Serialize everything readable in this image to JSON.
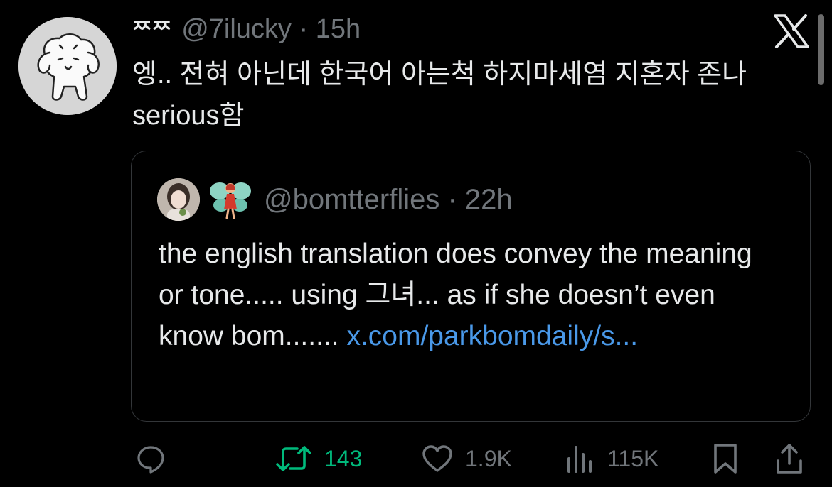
{
  "tweet": {
    "display_name": "ᄍᄍ",
    "handle": "@7ilucky",
    "separator": "·",
    "time": "15h",
    "text": "엥.. 전혀 아닌데 한국어 아는척 하지마세염 지혼자 존나 serious함"
  },
  "quoted": {
    "handle": "@bomtterflies",
    "separator": "·",
    "time": "22h",
    "text": "the english translation does convey the meaning or tone..... using 그녀... as if she doesn’t even know bom....... ",
    "link": "x.com/parkbomdaily/s..."
  },
  "actions": {
    "reply_count": "",
    "retweet_count": "143",
    "like_count": "1.9K",
    "views_count": "115K"
  },
  "colors": {
    "background": "#000000",
    "text": "#e7e9ea",
    "muted": "#71767b",
    "retweet": "#00ba7c",
    "link": "#4a99e9",
    "border": "#333639"
  },
  "icons": [
    "x-logo-icon",
    "reply-icon",
    "retweet-icon",
    "like-icon",
    "views-icon",
    "bookmark-icon",
    "share-icon"
  ]
}
